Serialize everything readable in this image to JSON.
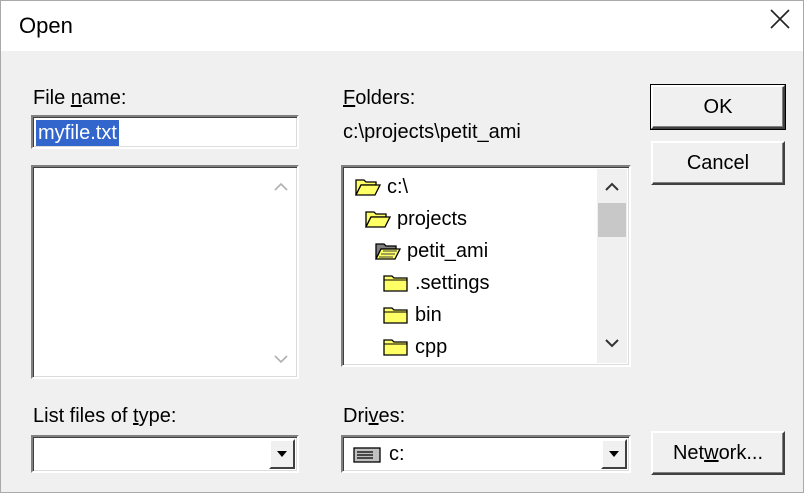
{
  "window": {
    "title": "Open"
  },
  "filename": {
    "label_pre": "File ",
    "label_mn": "n",
    "label_post": "ame:",
    "value": "myfile.txt"
  },
  "folders": {
    "label_mn": "F",
    "label_post": "olders:",
    "current_path": "c:\\projects\\petit_ami",
    "items": [
      {
        "name": "c:\\",
        "icon": "open-folder-icon"
      },
      {
        "name": "projects",
        "icon": "open-folder-icon"
      },
      {
        "name": "petit_ami",
        "icon": "open-folder-selected-icon"
      },
      {
        "name": ".settings",
        "icon": "folder-icon"
      },
      {
        "name": "bin",
        "icon": "folder-icon"
      },
      {
        "name": "cpp",
        "icon": "folder-icon"
      }
    ]
  },
  "file_types": {
    "label_pre": "List files of ",
    "label_mn": "t",
    "label_post": "ype:",
    "value": ""
  },
  "drives": {
    "label_pre": "Dri",
    "label_mn": "v",
    "label_post": "es:",
    "value": "c:",
    "icon": "drive-icon"
  },
  "buttons": {
    "ok": "OK",
    "cancel": "Cancel",
    "network_pre": "Net",
    "network_mn": "w",
    "network_post": "ork..."
  },
  "colors": {
    "dialog_bg": "#f0f0f0",
    "selection": "#3366cc",
    "folder_fill": "#ffff66"
  }
}
